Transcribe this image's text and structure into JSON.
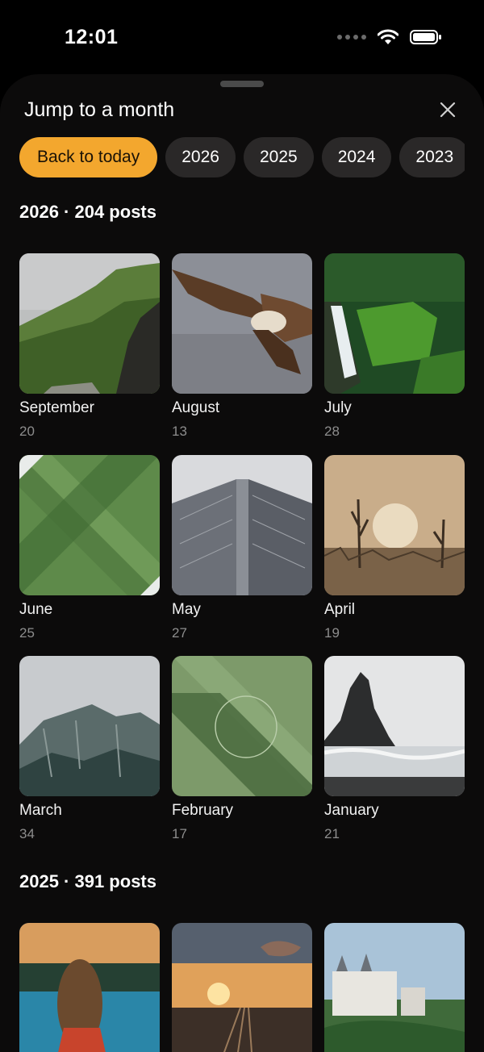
{
  "status": {
    "time": "12:01",
    "icons": [
      "signal-dots",
      "wifi-icon",
      "battery-icon"
    ]
  },
  "sheet": {
    "title": "Jump to a month",
    "close_icon": "close-icon",
    "chips": [
      "Back to today",
      "2026",
      "2025",
      "2024",
      "2023"
    ],
    "accent_color": "#f3a72e"
  },
  "years": [
    {
      "heading": "2026 · 204 posts",
      "months": [
        {
          "label": "September",
          "count": "20"
        },
        {
          "label": "August",
          "count": "13"
        },
        {
          "label": "July",
          "count": "28"
        },
        {
          "label": "June",
          "count": "25"
        },
        {
          "label": "May",
          "count": "27"
        },
        {
          "label": "April",
          "count": "19"
        },
        {
          "label": "March",
          "count": "34"
        },
        {
          "label": "February",
          "count": "17"
        },
        {
          "label": "January",
          "count": "21"
        }
      ]
    },
    {
      "heading": "2025 · 391 posts",
      "months": [
        {
          "label": "",
          "count": ""
        },
        {
          "label": "",
          "count": ""
        },
        {
          "label": "",
          "count": ""
        }
      ]
    }
  ]
}
